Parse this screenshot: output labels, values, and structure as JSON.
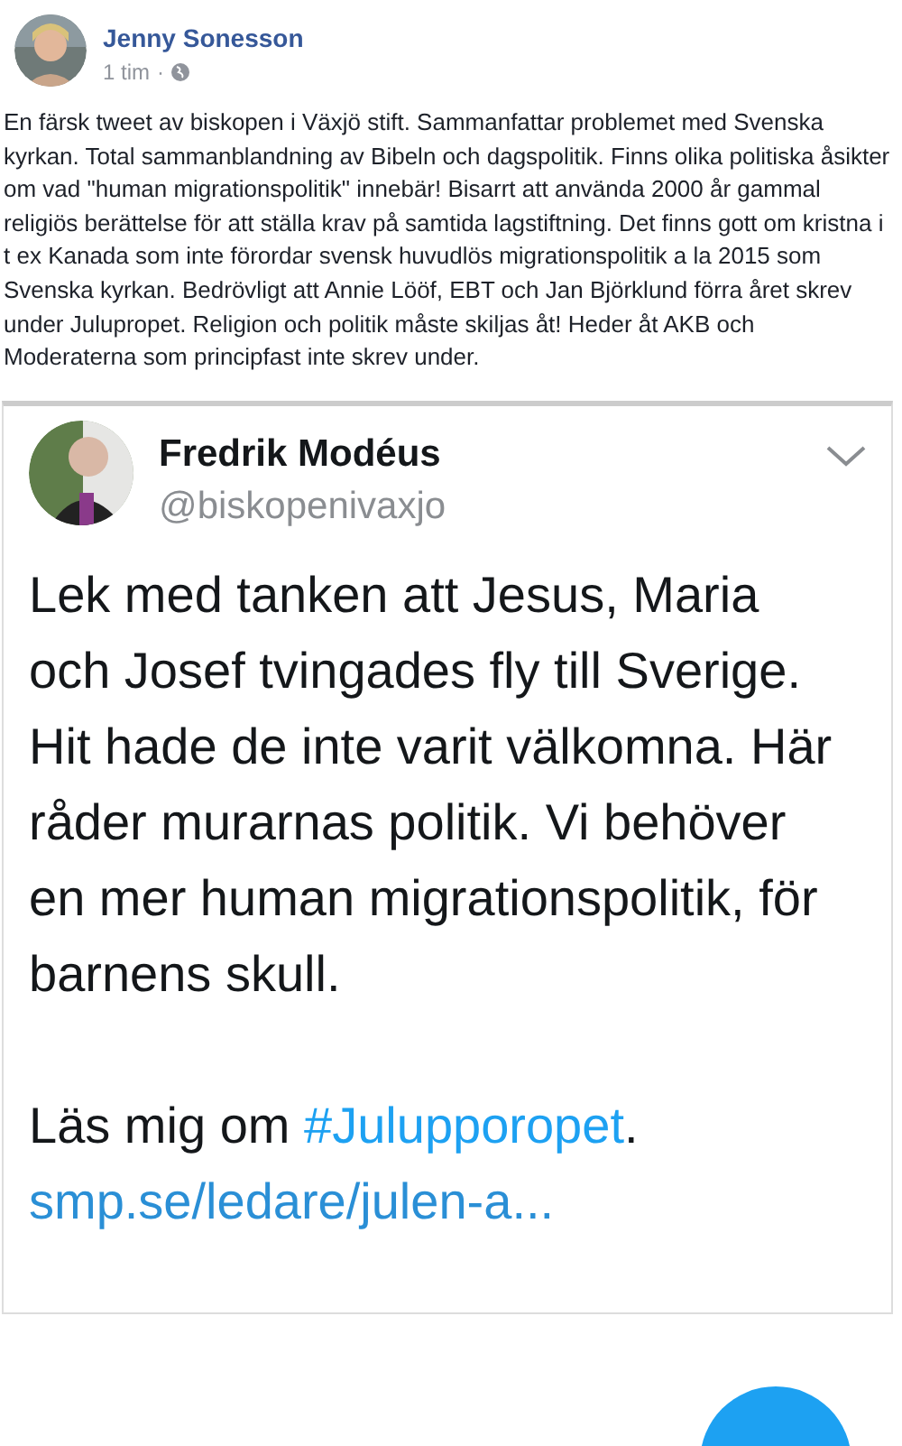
{
  "post": {
    "author": "Jenny Sonesson",
    "time": "1 tim",
    "separator": "·",
    "text": "En färsk tweet av biskopen i Växjö stift. Sammanfattar problemet med Svenska kyrkan. Total sammanblandning av Bibeln och dagspolitik. Finns olika politiska åsikter om vad \"human migrationspolitik\" innebär! Bisarrt att använda 2000 år gammal religiös berättelse för att ställa krav på samtida lagstiftning. Det finns gott om kristna i t ex Kanada som inte förordar svensk huvudlös migrationspolitik a la 2015 som Svenska kyrkan. Bedrövligt att Annie Lööf, EBT och Jan Björklund förra året skrev under Julupropet. Religion och politik måste skiljas åt! Heder åt AKB och Moderaterna som principfast inte skrev under."
  },
  "tweet": {
    "name": "Fredrik Modéus",
    "handle": "@biskopenivaxjo",
    "text": "Lek med tanken att Jesus, Maria och Josef tvingades fly till Sverige. Hit hade de inte varit välkomna. Här råder murarnas politik. Vi behöver en mer human migrationspolitik, för barnens skull.",
    "read_prefix": "Läs mig om ",
    "hashtag": "#Julupporopet",
    "read_suffix": ".",
    "link": "smp.se/ledare/julen-a..."
  }
}
